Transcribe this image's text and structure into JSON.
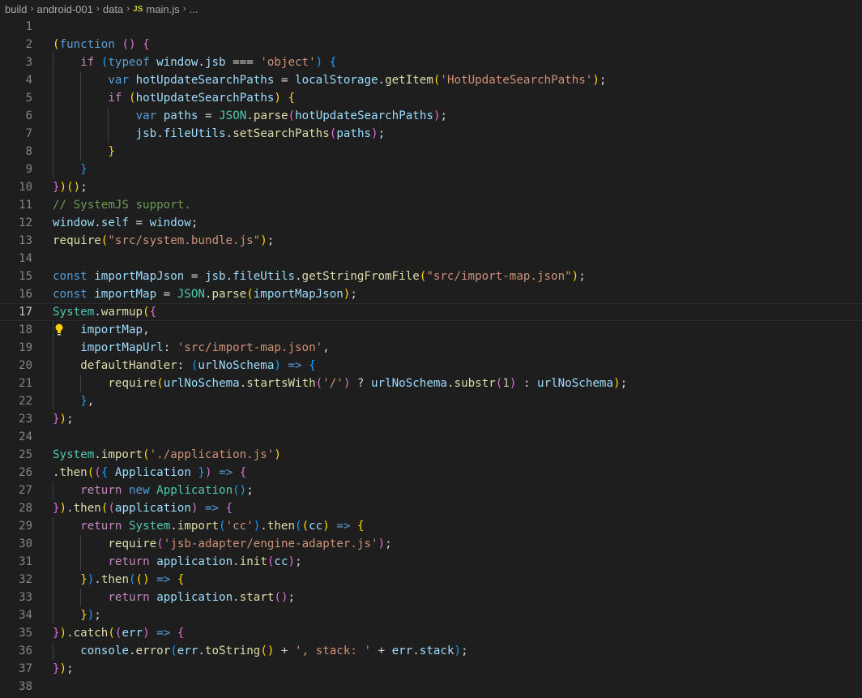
{
  "breadcrumb": {
    "items": [
      "build",
      "android-001",
      "data"
    ],
    "file_badge": "JS",
    "file_name": "main.js",
    "ellipsis": "..."
  },
  "editor": {
    "current_line": 17,
    "lines": [
      {
        "n": 1,
        "i": 0,
        "t": []
      },
      {
        "n": 2,
        "i": 0,
        "t": [
          [
            "b1",
            "("
          ],
          [
            "k",
            "function"
          ],
          [
            "o",
            " "
          ],
          [
            "b2",
            "()"
          ],
          [
            "o",
            " "
          ],
          [
            "b2",
            "{"
          ]
        ]
      },
      {
        "n": 3,
        "i": 1,
        "t": [
          [
            "c",
            "if"
          ],
          [
            "o",
            " "
          ],
          [
            "b3",
            "("
          ],
          [
            "k",
            "typeof"
          ],
          [
            "o",
            " "
          ],
          [
            "v",
            "window"
          ],
          [
            "o",
            "."
          ],
          [
            "v",
            "jsb"
          ],
          [
            "o",
            " === "
          ],
          [
            "s",
            "'object'"
          ],
          [
            "b3",
            ")"
          ],
          [
            "o",
            " "
          ],
          [
            "b3",
            "{"
          ]
        ]
      },
      {
        "n": 4,
        "i": 2,
        "t": [
          [
            "k",
            "var"
          ],
          [
            "o",
            " "
          ],
          [
            "v",
            "hotUpdateSearchPaths"
          ],
          [
            "o",
            " = "
          ],
          [
            "v",
            "localStorage"
          ],
          [
            "o",
            "."
          ],
          [
            "f",
            "getItem"
          ],
          [
            "b1",
            "("
          ],
          [
            "s",
            "'HotUpdateSearchPaths'"
          ],
          [
            "b1",
            ")"
          ],
          [
            "o",
            ";"
          ]
        ]
      },
      {
        "n": 5,
        "i": 2,
        "t": [
          [
            "c",
            "if"
          ],
          [
            "o",
            " "
          ],
          [
            "b1",
            "("
          ],
          [
            "v",
            "hotUpdateSearchPaths"
          ],
          [
            "b1",
            ")"
          ],
          [
            "o",
            " "
          ],
          [
            "b1",
            "{"
          ]
        ]
      },
      {
        "n": 6,
        "i": 3,
        "t": [
          [
            "k",
            "var"
          ],
          [
            "o",
            " "
          ],
          [
            "v",
            "paths"
          ],
          [
            "o",
            " = "
          ],
          [
            "t",
            "JSON"
          ],
          [
            "o",
            "."
          ],
          [
            "f",
            "parse"
          ],
          [
            "b2",
            "("
          ],
          [
            "v",
            "hotUpdateSearchPaths"
          ],
          [
            "b2",
            ")"
          ],
          [
            "o",
            ";"
          ]
        ]
      },
      {
        "n": 7,
        "i": 3,
        "t": [
          [
            "v",
            "jsb"
          ],
          [
            "o",
            "."
          ],
          [
            "v",
            "fileUtils"
          ],
          [
            "o",
            "."
          ],
          [
            "f",
            "setSearchPaths"
          ],
          [
            "b2",
            "("
          ],
          [
            "v",
            "paths"
          ],
          [
            "b2",
            ")"
          ],
          [
            "o",
            ";"
          ]
        ]
      },
      {
        "n": 8,
        "i": 2,
        "t": [
          [
            "b1",
            "}"
          ]
        ]
      },
      {
        "n": 9,
        "i": 1,
        "t": [
          [
            "b3",
            "}"
          ]
        ]
      },
      {
        "n": 10,
        "i": 0,
        "t": [
          [
            "b2",
            "}"
          ],
          [
            "b1",
            ")"
          ],
          [
            "b1",
            "()"
          ],
          [
            "o",
            ";"
          ]
        ]
      },
      {
        "n": 11,
        "i": 0,
        "t": [
          [
            "m",
            "// SystemJS support."
          ]
        ]
      },
      {
        "n": 12,
        "i": 0,
        "t": [
          [
            "v",
            "window"
          ],
          [
            "o",
            "."
          ],
          [
            "v",
            "self"
          ],
          [
            "o",
            " = "
          ],
          [
            "v",
            "window"
          ],
          [
            "o",
            ";"
          ]
        ]
      },
      {
        "n": 13,
        "i": 0,
        "t": [
          [
            "f",
            "require"
          ],
          [
            "b1",
            "("
          ],
          [
            "s",
            "\"src/system.bundle.js\""
          ],
          [
            "b1",
            ")"
          ],
          [
            "o",
            ";"
          ]
        ]
      },
      {
        "n": 14,
        "i": 0,
        "t": []
      },
      {
        "n": 15,
        "i": 0,
        "t": [
          [
            "k",
            "const"
          ],
          [
            "o",
            " "
          ],
          [
            "v",
            "importMapJson"
          ],
          [
            "o",
            " = "
          ],
          [
            "v",
            "jsb"
          ],
          [
            "o",
            "."
          ],
          [
            "v",
            "fileUtils"
          ],
          [
            "o",
            "."
          ],
          [
            "f",
            "getStringFromFile"
          ],
          [
            "b1",
            "("
          ],
          [
            "s",
            "\"src/import-map.json\""
          ],
          [
            "b1",
            ")"
          ],
          [
            "o",
            ";"
          ]
        ]
      },
      {
        "n": 16,
        "i": 0,
        "t": [
          [
            "k",
            "const"
          ],
          [
            "o",
            " "
          ],
          [
            "v",
            "importMap"
          ],
          [
            "o",
            " = "
          ],
          [
            "t",
            "JSON"
          ],
          [
            "o",
            "."
          ],
          [
            "f",
            "parse"
          ],
          [
            "b1",
            "("
          ],
          [
            "v",
            "importMapJson"
          ],
          [
            "b1",
            ")"
          ],
          [
            "o",
            ";"
          ]
        ]
      },
      {
        "n": 17,
        "i": 0,
        "t": [
          [
            "t",
            "System"
          ],
          [
            "o",
            "."
          ],
          [
            "f",
            "warmup"
          ],
          [
            "b1",
            "("
          ],
          [
            "b2",
            "{"
          ]
        ]
      },
      {
        "n": 18,
        "i": 1,
        "t": [
          [
            "v",
            "importMap"
          ],
          [
            "o",
            ","
          ]
        ]
      },
      {
        "n": 19,
        "i": 1,
        "t": [
          [
            "v",
            "importMapUrl"
          ],
          [
            "o",
            ": "
          ],
          [
            "s",
            "'src/import-map.json'"
          ],
          [
            "o",
            ","
          ]
        ]
      },
      {
        "n": 20,
        "i": 1,
        "t": [
          [
            "f",
            "defaultHandler"
          ],
          [
            "o",
            ": "
          ],
          [
            "b3",
            "("
          ],
          [
            "v",
            "urlNoSchema"
          ],
          [
            "b3",
            ")"
          ],
          [
            "o",
            " "
          ],
          [
            "k",
            "=>"
          ],
          [
            "o",
            " "
          ],
          [
            "b3",
            "{"
          ]
        ]
      },
      {
        "n": 21,
        "i": 2,
        "t": [
          [
            "f",
            "require"
          ],
          [
            "b1",
            "("
          ],
          [
            "v",
            "urlNoSchema"
          ],
          [
            "o",
            "."
          ],
          [
            "f",
            "startsWith"
          ],
          [
            "b2",
            "("
          ],
          [
            "s",
            "'/'"
          ],
          [
            "b2",
            ")"
          ],
          [
            "o",
            " ? "
          ],
          [
            "v",
            "urlNoSchema"
          ],
          [
            "o",
            "."
          ],
          [
            "f",
            "substr"
          ],
          [
            "b2",
            "("
          ],
          [
            "n",
            "1"
          ],
          [
            "b2",
            ")"
          ],
          [
            "o",
            " : "
          ],
          [
            "v",
            "urlNoSchema"
          ],
          [
            "b1",
            ")"
          ],
          [
            "o",
            ";"
          ]
        ]
      },
      {
        "n": 22,
        "i": 1,
        "t": [
          [
            "b3",
            "}"
          ],
          [
            "o",
            ","
          ]
        ]
      },
      {
        "n": 23,
        "i": 0,
        "t": [
          [
            "b2",
            "}"
          ],
          [
            "b1",
            ")"
          ],
          [
            "o",
            ";"
          ]
        ]
      },
      {
        "n": 24,
        "i": 0,
        "t": []
      },
      {
        "n": 25,
        "i": 0,
        "t": [
          [
            "t",
            "System"
          ],
          [
            "o",
            "."
          ],
          [
            "f",
            "import"
          ],
          [
            "b1",
            "("
          ],
          [
            "s",
            "'./application.js'"
          ],
          [
            "b1",
            ")"
          ]
        ]
      },
      {
        "n": 26,
        "i": 0,
        "t": [
          [
            "o",
            "."
          ],
          [
            "f",
            "then"
          ],
          [
            "b1",
            "("
          ],
          [
            "b2",
            "("
          ],
          [
            "b3",
            "{"
          ],
          [
            "o",
            " "
          ],
          [
            "v",
            "Application"
          ],
          [
            "o",
            " "
          ],
          [
            "b3",
            "}"
          ],
          [
            "b2",
            ")"
          ],
          [
            "o",
            " "
          ],
          [
            "k",
            "=>"
          ],
          [
            "o",
            " "
          ],
          [
            "b2",
            "{"
          ]
        ]
      },
      {
        "n": 27,
        "i": 1,
        "t": [
          [
            "c",
            "return"
          ],
          [
            "o",
            " "
          ],
          [
            "k",
            "new"
          ],
          [
            "o",
            " "
          ],
          [
            "t",
            "Application"
          ],
          [
            "b3",
            "()"
          ],
          [
            "o",
            ";"
          ]
        ]
      },
      {
        "n": 28,
        "i": 0,
        "t": [
          [
            "b2",
            "}"
          ],
          [
            "b1",
            ")"
          ],
          [
            "o",
            "."
          ],
          [
            "f",
            "then"
          ],
          [
            "b1",
            "("
          ],
          [
            "b2",
            "("
          ],
          [
            "v",
            "application"
          ],
          [
            "b2",
            ")"
          ],
          [
            "o",
            " "
          ],
          [
            "k",
            "=>"
          ],
          [
            "o",
            " "
          ],
          [
            "b2",
            "{"
          ]
        ]
      },
      {
        "n": 29,
        "i": 1,
        "t": [
          [
            "c",
            "return"
          ],
          [
            "o",
            " "
          ],
          [
            "t",
            "System"
          ],
          [
            "o",
            "."
          ],
          [
            "f",
            "import"
          ],
          [
            "b3",
            "("
          ],
          [
            "s",
            "'cc'"
          ],
          [
            "b3",
            ")"
          ],
          [
            "o",
            "."
          ],
          [
            "f",
            "then"
          ],
          [
            "b3",
            "("
          ],
          [
            "b1",
            "("
          ],
          [
            "v",
            "cc"
          ],
          [
            "b1",
            ")"
          ],
          [
            "o",
            " "
          ],
          [
            "k",
            "=>"
          ],
          [
            "o",
            " "
          ],
          [
            "b1",
            "{"
          ]
        ]
      },
      {
        "n": 30,
        "i": 2,
        "t": [
          [
            "f",
            "require"
          ],
          [
            "b2",
            "("
          ],
          [
            "s",
            "'jsb-adapter/engine-adapter.js'"
          ],
          [
            "b2",
            ")"
          ],
          [
            "o",
            ";"
          ]
        ]
      },
      {
        "n": 31,
        "i": 2,
        "t": [
          [
            "c",
            "return"
          ],
          [
            "o",
            " "
          ],
          [
            "v",
            "application"
          ],
          [
            "o",
            "."
          ],
          [
            "f",
            "init"
          ],
          [
            "b2",
            "("
          ],
          [
            "v",
            "cc"
          ],
          [
            "b2",
            ")"
          ],
          [
            "o",
            ";"
          ]
        ]
      },
      {
        "n": 32,
        "i": 1,
        "t": [
          [
            "b1",
            "}"
          ],
          [
            "b3",
            ")"
          ],
          [
            "o",
            "."
          ],
          [
            "f",
            "then"
          ],
          [
            "b3",
            "("
          ],
          [
            "b1",
            "()"
          ],
          [
            "o",
            " "
          ],
          [
            "k",
            "=>"
          ],
          [
            "o",
            " "
          ],
          [
            "b1",
            "{"
          ]
        ]
      },
      {
        "n": 33,
        "i": 2,
        "t": [
          [
            "c",
            "return"
          ],
          [
            "o",
            " "
          ],
          [
            "v",
            "application"
          ],
          [
            "o",
            "."
          ],
          [
            "f",
            "start"
          ],
          [
            "b2",
            "()"
          ],
          [
            "o",
            ";"
          ]
        ]
      },
      {
        "n": 34,
        "i": 1,
        "t": [
          [
            "b1",
            "}"
          ],
          [
            "b3",
            ")"
          ],
          [
            "o",
            ";"
          ]
        ]
      },
      {
        "n": 35,
        "i": 0,
        "t": [
          [
            "b2",
            "}"
          ],
          [
            "b1",
            ")"
          ],
          [
            "o",
            "."
          ],
          [
            "f",
            "catch"
          ],
          [
            "b1",
            "("
          ],
          [
            "b2",
            "("
          ],
          [
            "v",
            "err"
          ],
          [
            "b2",
            ")"
          ],
          [
            "o",
            " "
          ],
          [
            "k",
            "=>"
          ],
          [
            "o",
            " "
          ],
          [
            "b2",
            "{"
          ]
        ]
      },
      {
        "n": 36,
        "i": 1,
        "t": [
          [
            "v",
            "console"
          ],
          [
            "o",
            "."
          ],
          [
            "f",
            "error"
          ],
          [
            "b3",
            "("
          ],
          [
            "v",
            "err"
          ],
          [
            "o",
            "."
          ],
          [
            "f",
            "toString"
          ],
          [
            "b1",
            "()"
          ],
          [
            "o",
            " + "
          ],
          [
            "s",
            "', stack: '"
          ],
          [
            "o",
            " + "
          ],
          [
            "v",
            "err"
          ],
          [
            "o",
            "."
          ],
          [
            "v",
            "stack"
          ],
          [
            "b3",
            ")"
          ],
          [
            "o",
            ";"
          ]
        ]
      },
      {
        "n": 37,
        "i": 0,
        "t": [
          [
            "b2",
            "}"
          ],
          [
            "b1",
            ")"
          ],
          [
            "o",
            ";"
          ]
        ]
      },
      {
        "n": 38,
        "i": 0,
        "t": []
      }
    ]
  }
}
